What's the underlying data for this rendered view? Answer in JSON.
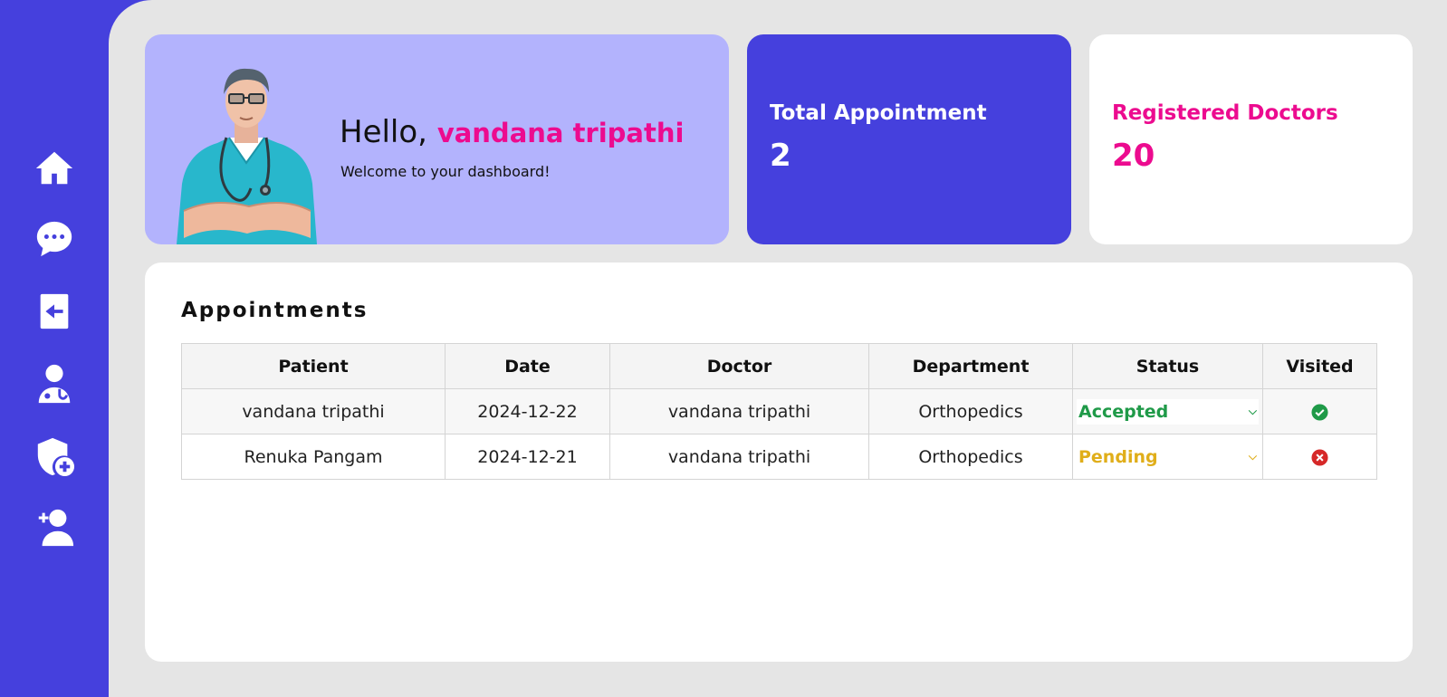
{
  "sidebar": {
    "items": [
      {
        "name": "home",
        "icon": "home-icon"
      },
      {
        "name": "messages",
        "icon": "chat-icon"
      },
      {
        "name": "logout",
        "icon": "logout-icon"
      },
      {
        "name": "doctors",
        "icon": "doctor-icon"
      },
      {
        "name": "add-admin",
        "icon": "shield-plus-icon"
      },
      {
        "name": "add-doctor",
        "icon": "user-plus-icon"
      }
    ]
  },
  "welcome_card": {
    "greeting": "Hello,",
    "name": "vandana tripathi",
    "subtitle": "Welcome to your dashboard!"
  },
  "stats": {
    "total_appointments": {
      "label": "Total Appointment",
      "value": "2"
    },
    "registered_doctors": {
      "label": "Registered Doctors",
      "value": "20"
    }
  },
  "appointments": {
    "title": "Appointments",
    "columns": [
      "Patient",
      "Date",
      "Doctor",
      "Department",
      "Status",
      "Visited"
    ],
    "rows": [
      {
        "patient": "vandana tripathi",
        "date": "2024-12-22",
        "doctor": "vandana tripathi",
        "department": "Orthopedics",
        "status": "Accepted",
        "visited": true
      },
      {
        "patient": "Renuka Pangam",
        "date": "2024-12-21",
        "doctor": "vandana tripathi",
        "department": "Orthopedics",
        "status": "Pending",
        "visited": false
      }
    ]
  },
  "colors": {
    "primary": "#4540dd",
    "accent_pink": "#ec0b8f",
    "card_lavender": "#b3b3fd",
    "status_accepted": "#1f9a48",
    "status_pending": "#e0ae1a",
    "visited_yes": "#1f9a48",
    "visited_no": "#d62828"
  }
}
